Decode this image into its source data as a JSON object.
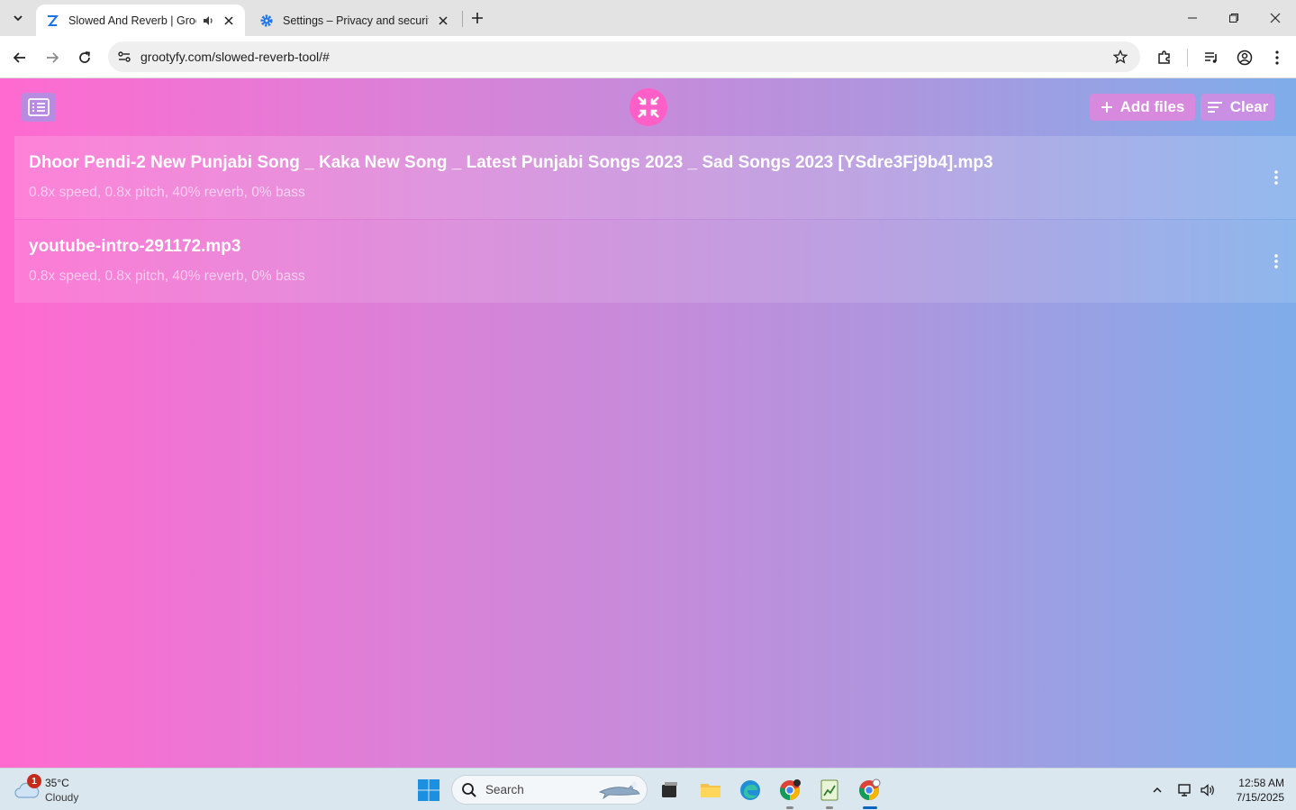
{
  "browser": {
    "tabs": [
      {
        "title": "Slowed And Reverb | Grootyfy",
        "active": true
      },
      {
        "title": "Settings – Privacy and security",
        "active": false
      }
    ],
    "url": "grootyfy.com/slowed-reverb-tool/#"
  },
  "app": {
    "add_files_label": "Add files",
    "clear_label": "Clear",
    "files": [
      {
        "name": "Dhoor Pendi-2 New Punjabi Song _ Kaka New Song _ Latest Punjabi Songs 2023 _ Sad Songs 2023 [YSdre3Fj9b4].mp3",
        "settings": "0.8x speed, 0.8x pitch, 40% reverb, 0% bass"
      },
      {
        "name": "youtube-intro-291172.mp3",
        "settings": "0.8x speed, 0.8x pitch, 40% reverb, 0% bass"
      }
    ],
    "colors": {
      "gradient_start": "#ff6ad0",
      "gradient_end": "#7fadea",
      "logo_bg": "#ff5fc7"
    }
  },
  "taskbar": {
    "weather": {
      "badge": "1",
      "temp": "35°C",
      "condition": "Cloudy"
    },
    "search_placeholder": "Search",
    "clock": {
      "time": "12:58 AM",
      "date": "7/15/2025"
    }
  }
}
